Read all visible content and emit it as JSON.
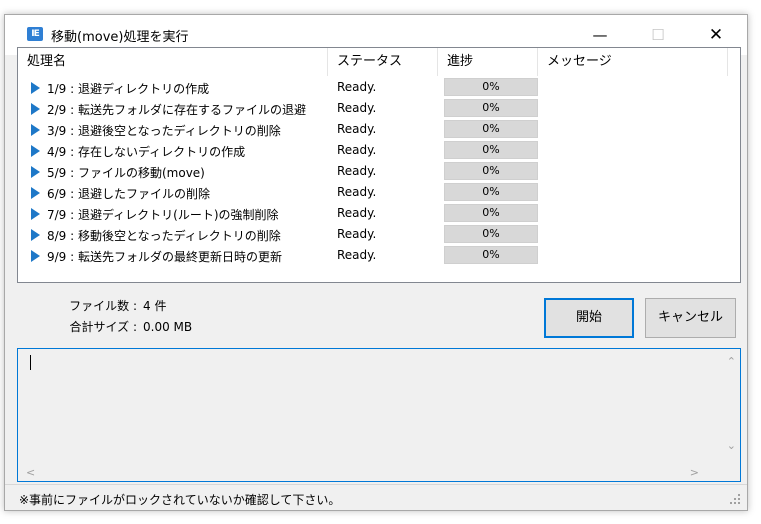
{
  "window": {
    "title": "移動(move)処理を実行",
    "icon": "app-icon",
    "min_symbol": "—",
    "max_symbol": "☐",
    "close_symbol": "✕"
  },
  "table": {
    "headers": [
      "処理名",
      "ステータス",
      "進捗",
      "メッセージ"
    ],
    "rows": [
      {
        "name": "1/9 : 退避ディレクトリの作成",
        "status": "Ready.",
        "progress": "0%",
        "message": ""
      },
      {
        "name": "2/9 : 転送先フォルダに存在するファイルの退避",
        "status": "Ready.",
        "progress": "0%",
        "message": ""
      },
      {
        "name": "3/9 : 退避後空となったディレクトリの削除",
        "status": "Ready.",
        "progress": "0%",
        "message": ""
      },
      {
        "name": "4/9 : 存在しないディレクトリの作成",
        "status": "Ready.",
        "progress": "0%",
        "message": ""
      },
      {
        "name": "5/9 : ファイルの移動(move)",
        "status": "Ready.",
        "progress": "0%",
        "message": ""
      },
      {
        "name": "6/9 : 退避したファイルの削除",
        "status": "Ready.",
        "progress": "0%",
        "message": ""
      },
      {
        "name": "7/9 : 退避ディレクトリ(ルート)の強制削除",
        "status": "Ready.",
        "progress": "0%",
        "message": ""
      },
      {
        "name": "8/9 : 移動後空となったディレクトリの削除",
        "status": "Ready.",
        "progress": "0%",
        "message": ""
      },
      {
        "name": "9/9 : 転送先フォルダの最終更新日時の更新",
        "status": "Ready.",
        "progress": "0%",
        "message": ""
      }
    ]
  },
  "stats": {
    "files_label": "ファイル数 :",
    "files_value": "4 件",
    "size_label": "合計サイズ :",
    "size_value": "0.00 MB"
  },
  "buttons": {
    "start": "開始",
    "cancel": "キャンセル"
  },
  "log": {
    "value": ""
  },
  "status_bar": {
    "text": "※事前にファイルがロックされていないか確認して下さい。"
  },
  "colors": {
    "accent": "#0078d7",
    "row_icon": "#1e78c8",
    "progress_bg": "#d8d8d8"
  }
}
